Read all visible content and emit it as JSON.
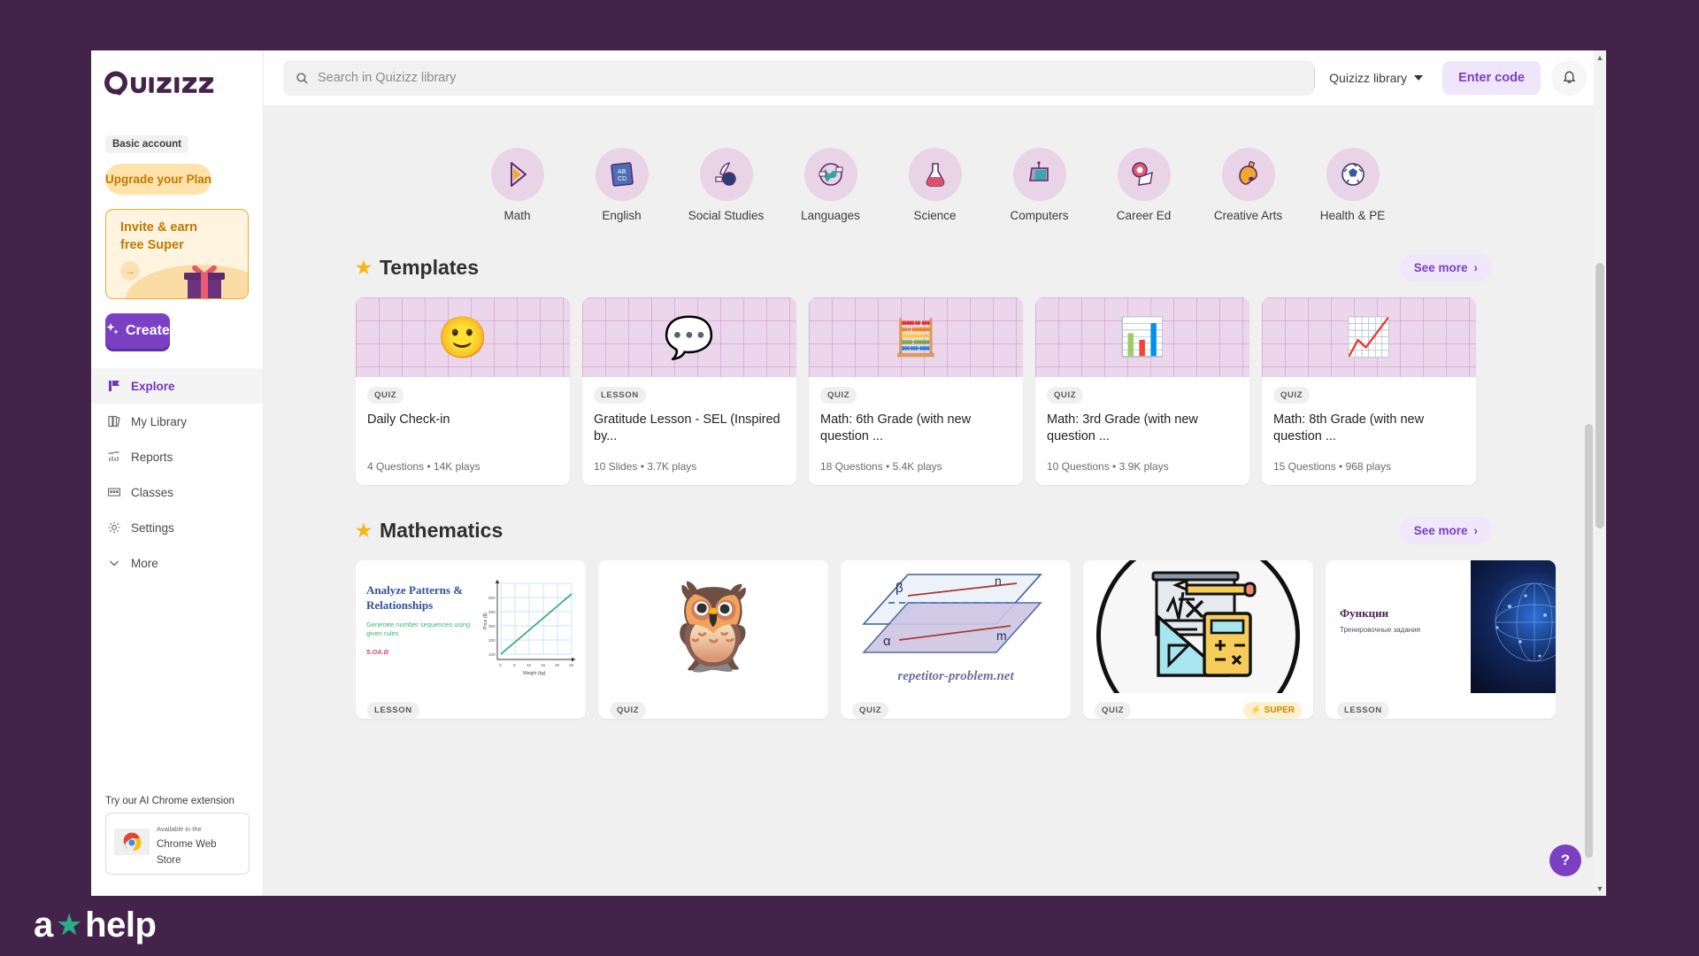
{
  "brand": {
    "logo_text": "Quizizz",
    "accent": "#7b3fc4",
    "dark": "#43234a"
  },
  "watermark": {
    "text_before": "a",
    "star": "★",
    "text_after": "help"
  },
  "sidebar": {
    "account_badge": "Basic account",
    "upgrade_label": "Upgrade your Plan",
    "invite": {
      "title": "Invite & earn free Super",
      "arrow": "→"
    },
    "create_label": "Create",
    "nav": [
      {
        "label": "Explore",
        "icon": "compass-icon",
        "active": true
      },
      {
        "label": "My Library",
        "icon": "library-icon",
        "active": false
      },
      {
        "label": "Reports",
        "icon": "reports-chart-icon",
        "active": false
      },
      {
        "label": "Classes",
        "icon": "classes-icon",
        "active": false
      },
      {
        "label": "Settings",
        "icon": "gear-icon",
        "active": false
      },
      {
        "label": "More",
        "icon": "chevron-down-icon",
        "active": false
      }
    ],
    "extension": {
      "title": "Try our AI Chrome extension",
      "line1": "Available in the",
      "line2": "Chrome Web Store"
    }
  },
  "header": {
    "search_placeholder": "Search in Quizizz library",
    "search_value": "",
    "library_select": "Quizizz library",
    "enter_code_label": "Enter code",
    "bell_icon": "bell-icon"
  },
  "subjects": [
    {
      "label": "Math",
      "icon": "protractor-icon"
    },
    {
      "label": "English",
      "icon": "abcd-book-icon"
    },
    {
      "label": "Social Studies",
      "icon": "quill-inkpot-icon"
    },
    {
      "label": "Languages",
      "icon": "globe-icon"
    },
    {
      "label": "Science",
      "icon": "flask-icon"
    },
    {
      "label": "Computers",
      "icon": "laptop-icon"
    },
    {
      "label": "Career Ed",
      "icon": "lifebuoy-map-icon"
    },
    {
      "label": "Creative Arts",
      "icon": "palette-icon"
    },
    {
      "label": "Health & PE",
      "icon": "soccer-ball-icon"
    }
  ],
  "sections": [
    {
      "title": "Templates",
      "see_more": "See more",
      "cards": [
        {
          "tag": "QUIZ",
          "title": "Daily Check-in",
          "meta": "4 Questions  •  14K plays",
          "emoji": "🙂",
          "thumb": "grid"
        },
        {
          "tag": "LESSON",
          "title": "Gratitude Lesson - SEL (Inspired by...",
          "meta": "10 Slides  •  3.7K plays",
          "emoji": "💬",
          "thumb": "grid"
        },
        {
          "tag": "QUIZ",
          "title": "Math: 6th Grade (with new question ...",
          "meta": "18 Questions  •  5.4K plays",
          "emoji": "🧮",
          "thumb": "grid"
        },
        {
          "tag": "QUIZ",
          "title": "Math: 3rd Grade (with new question ...",
          "meta": "10 Questions  •  3.9K plays",
          "emoji": "📊",
          "thumb": "grid"
        },
        {
          "tag": "QUIZ",
          "title": "Math: 8th Grade (with new question ...",
          "meta": "15 Questions  •  968 plays",
          "emoji": "📈",
          "thumb": "grid"
        }
      ]
    },
    {
      "title": "Mathematics",
      "see_more": "See more",
      "cards": [
        {
          "tag": "LESSON",
          "thumb": "chart-lesson",
          "thumb_title": "Analyze Patterns & Relationships",
          "thumb_sub": "Generate number sequences using given rules",
          "thumb_code": "5.OA.B",
          "chart_xlabel": "Weight (kg)",
          "chart_ylabel": "Price ($)"
        },
        {
          "tag": "QUIZ",
          "thumb": "owl"
        },
        {
          "tag": "QUIZ",
          "thumb": "planes",
          "plane_top": "β",
          "plane_bottom": "α",
          "line_top": "n",
          "line_bottom": "m",
          "site": "repetitor-problem.net"
        },
        {
          "tag": "QUIZ",
          "thumb": "math-tools",
          "badge": "SUPER",
          "badge_icon": "bolt-icon"
        },
        {
          "tag": "LESSON",
          "thumb": "functions",
          "thumb_title": "Функции",
          "thumb_sub": "Тренировочные задания"
        }
      ]
    }
  ],
  "help_button": {
    "label": "?"
  },
  "chart_data": {
    "type": "line",
    "title": "Analyze Patterns & Relationships",
    "xlabel": "Weight (kg)",
    "ylabel": "Price ($)",
    "x": [
      0,
      5,
      10,
      15,
      20,
      25
    ],
    "y": [
      0,
      100,
      200,
      300,
      400,
      500
    ],
    "xticks": [
      "0",
      "5",
      "10",
      "15",
      "20",
      "25"
    ],
    "yticks": [
      "100",
      "200",
      "300",
      "400",
      "500"
    ],
    "xlim": [
      0,
      25
    ],
    "ylim": [
      0,
      500
    ],
    "grid": true,
    "legend": "none",
    "series": [
      {
        "name": "price",
        "values": [
          0,
          100,
          200,
          300,
          400,
          500
        ]
      }
    ]
  }
}
